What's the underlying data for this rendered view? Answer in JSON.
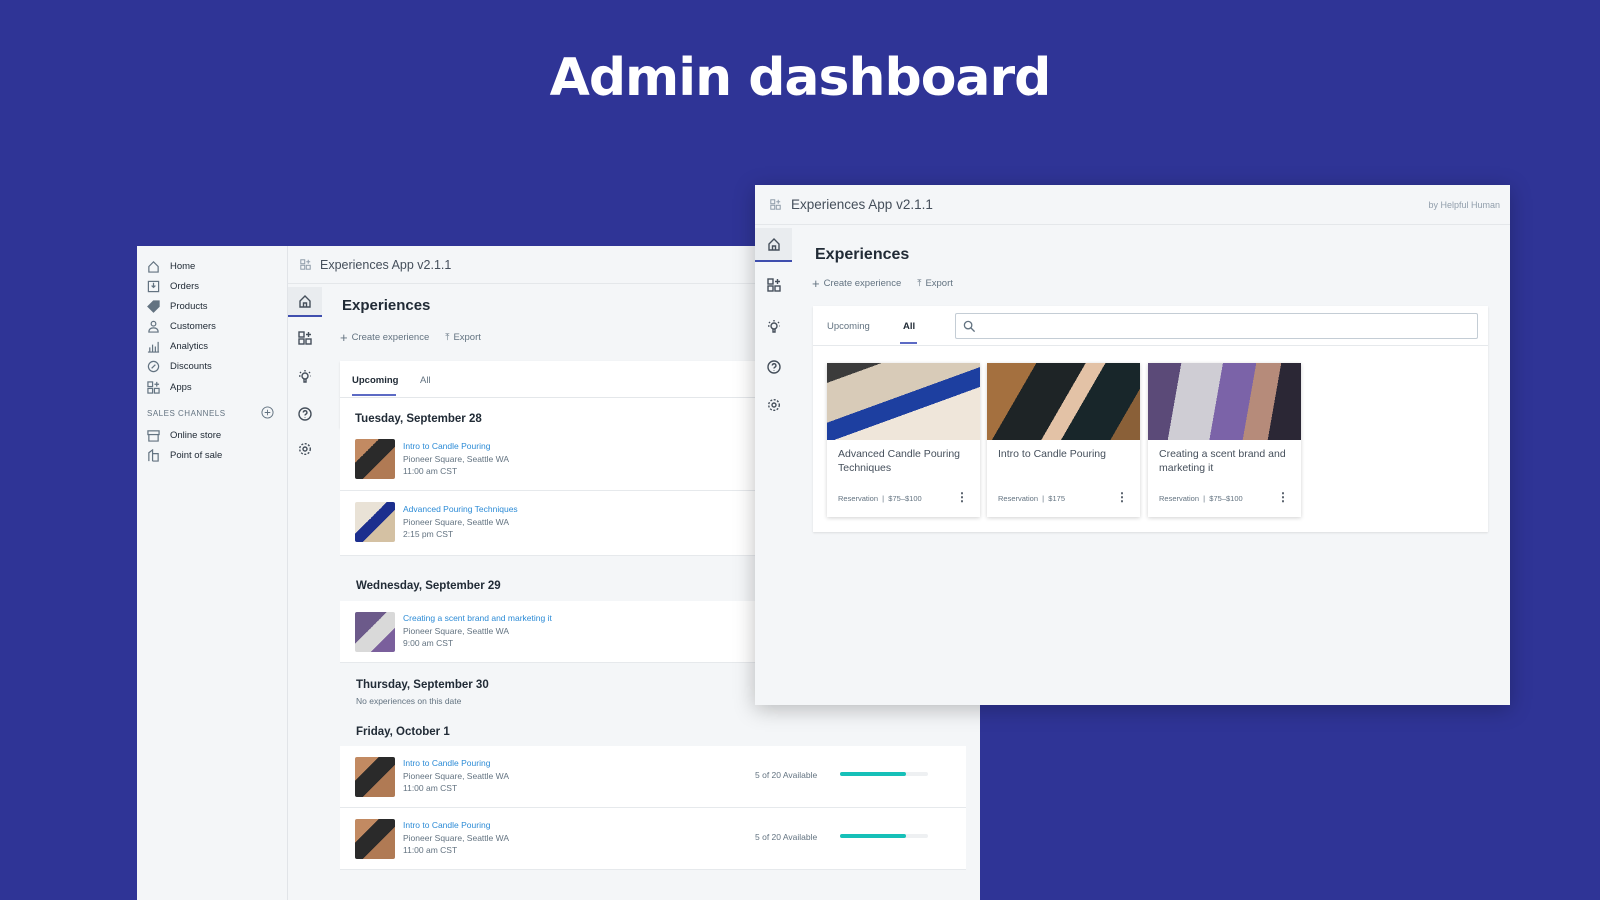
{
  "hero_title": "Admin dashboard",
  "admin_sidebar": {
    "items": [
      {
        "label": "Home",
        "icon": "home-icon"
      },
      {
        "label": "Orders",
        "icon": "orders-icon"
      },
      {
        "label": "Products",
        "icon": "tag-icon"
      },
      {
        "label": "Customers",
        "icon": "person-icon"
      },
      {
        "label": "Analytics",
        "icon": "bar-chart-icon"
      },
      {
        "label": "Discounts",
        "icon": "discount-icon"
      },
      {
        "label": "Apps",
        "icon": "apps-icon"
      }
    ],
    "sales_channels_label": "SALES CHANNELS",
    "channels": [
      {
        "label": "Online store",
        "icon": "store-icon"
      },
      {
        "label": "Point of sale",
        "icon": "pos-icon"
      }
    ]
  },
  "app": {
    "title": "Experiences App v2.1.1",
    "byline": "by Helpful Human",
    "page_title": "Experiences",
    "create_label": "Create experience",
    "export_label": "Export",
    "tabs": [
      "Upcoming",
      "All"
    ],
    "search_placeholder": ""
  },
  "back_list": {
    "days": [
      {
        "date": "Tuesday, September 28"
      },
      {
        "date": "Wednesday, September 29"
      },
      {
        "date": "Thursday, September 30",
        "empty": "No experiences on this date"
      },
      {
        "date": "Friday, October 1"
      }
    ],
    "rows": [
      {
        "title": "Intro to Candle Pouring",
        "location": "Pioneer Square, Seattle WA",
        "time": "11:00 am CST"
      },
      {
        "title": "Advanced Pouring Techniques",
        "location": "Pioneer Square, Seattle WA",
        "time": "2:15 pm CST"
      },
      {
        "title": "Creating a scent brand and marketing it",
        "location": "Pioneer Square, Seattle WA",
        "time": "9:00 am CST"
      },
      {
        "title": "Intro to Candle Pouring",
        "location": "Pioneer Square, Seattle WA",
        "time": "11:00 am CST",
        "availability": "5 of 20 Available",
        "fill": 0.75
      },
      {
        "title": "Intro to Candle Pouring",
        "location": "Pioneer Square, Seattle WA",
        "time": "11:00 am CST",
        "availability": "5 of 20 Available",
        "fill": 0.75
      }
    ]
  },
  "cards": [
    {
      "title": "Advanced Candle Pouring Techniques",
      "meta": "Reservation  |  $75–$100"
    },
    {
      "title": "Intro to Candle Pouring",
      "meta": "Reservation  |  $175"
    },
    {
      "title": "Creating a scent brand and marketing it",
      "meta": "Reservation  |  $75–$100"
    }
  ],
  "colors": {
    "background": "#2f3496",
    "accent": "#5c6ac4",
    "link": "#2c8bd6",
    "progress": "#16c0b8"
  }
}
